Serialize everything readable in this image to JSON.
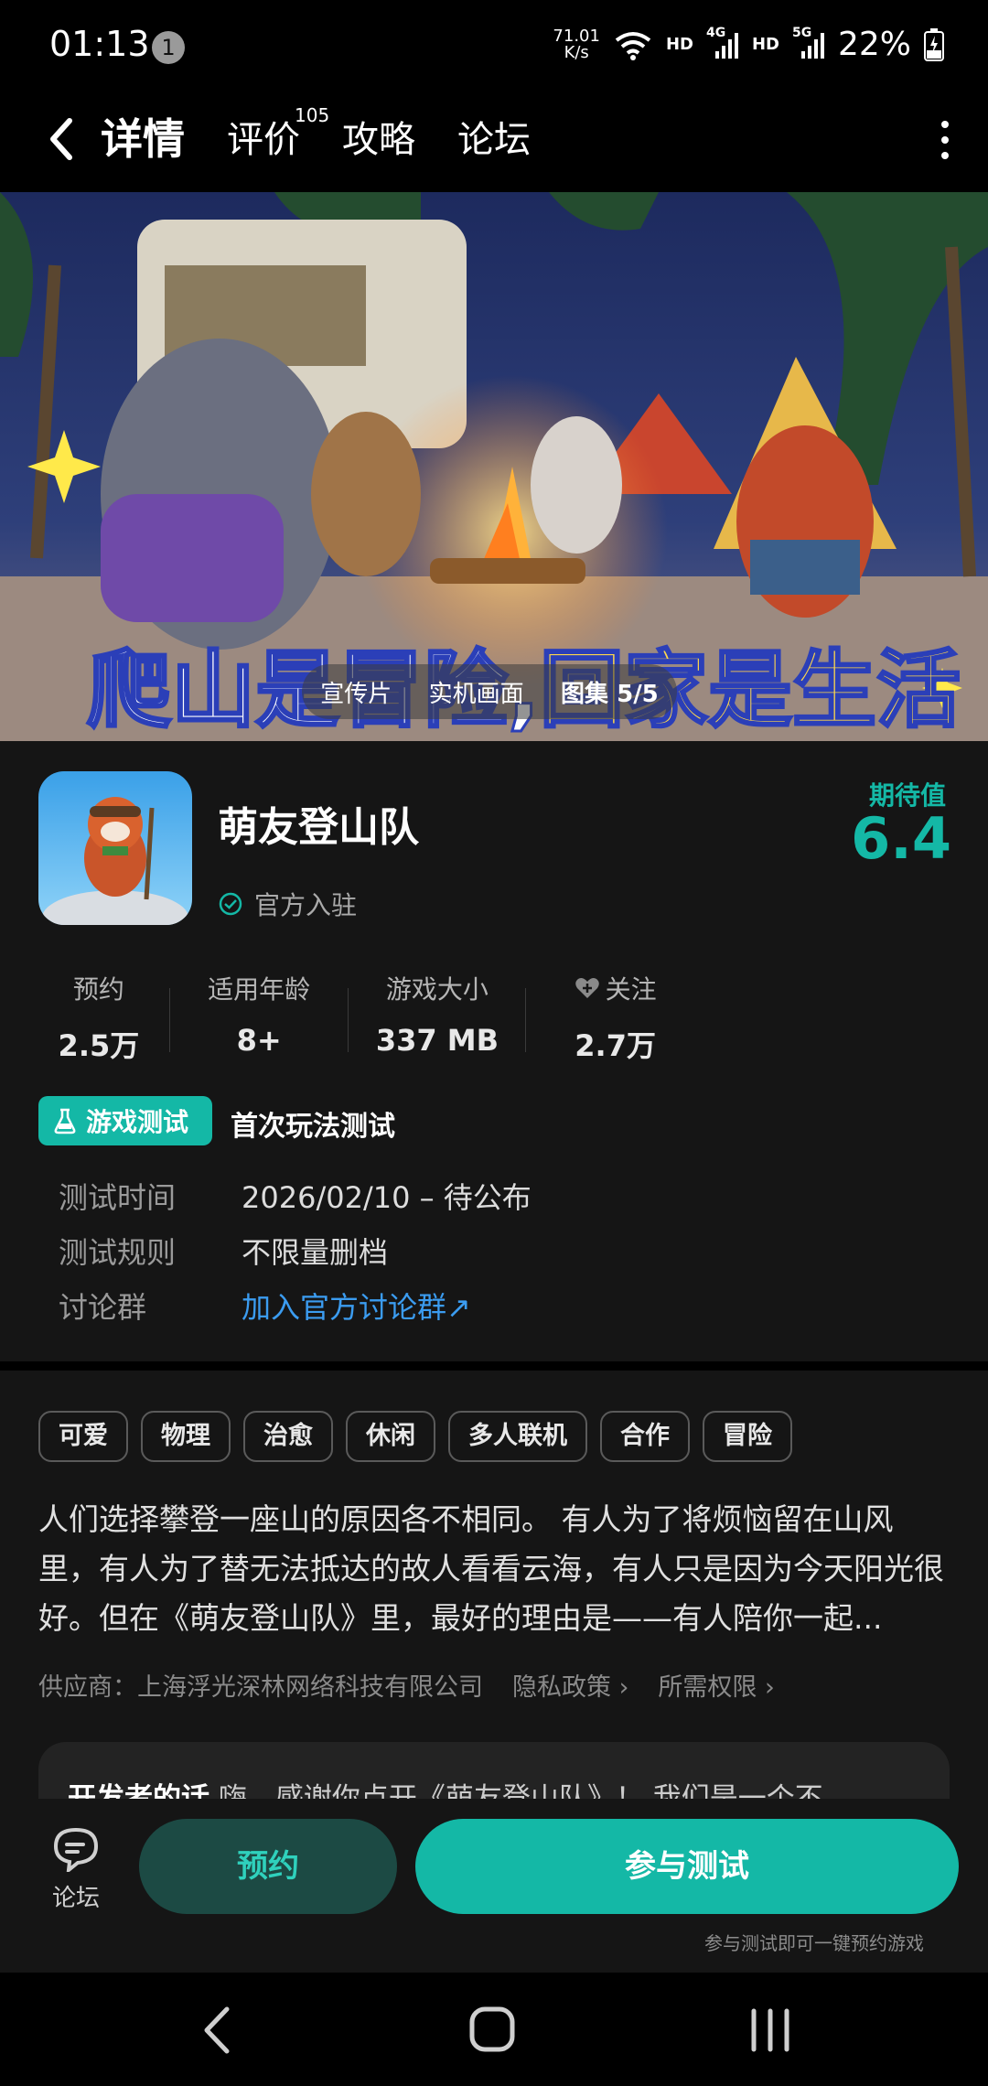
{
  "status_bar": {
    "time": "01:13",
    "notification_count": "1",
    "net_speed_value": "71.01",
    "net_speed_unit": "K/s",
    "hd1": "HD",
    "sig1": "4G",
    "hd2": "HD",
    "sig2": "5G",
    "battery": "22%"
  },
  "nav": {
    "tabs": [
      {
        "label": "详情"
      },
      {
        "label": "评价",
        "badge": "105"
      },
      {
        "label": "攻略"
      },
      {
        "label": "论坛"
      }
    ]
  },
  "hero": {
    "caption_part1": "爬山是冒险,",
    "caption_part2": "回家是生活",
    "media_tabs": [
      "宣传片",
      "实机画面",
      "图集 5/5"
    ]
  },
  "app": {
    "name": "萌友登山队",
    "official_label": "官方入驻",
    "score_label": "期待值",
    "score_value": "6.4"
  },
  "stats": [
    {
      "label": "预约",
      "value": "2.5万"
    },
    {
      "label": "适用年龄",
      "value": "8+"
    },
    {
      "label": "游戏大小",
      "value": "337 MB"
    },
    {
      "label": "关注",
      "value": "2.7万"
    }
  ],
  "test": {
    "badge": "游戏测试",
    "title": "首次玩法测试",
    "rows": [
      {
        "key": "测试时间",
        "value": "2026/02/10 – 待公布"
      },
      {
        "key": "测试规则",
        "value": "不限量删档"
      },
      {
        "key": "讨论群",
        "value": "加入官方讨论群↗"
      }
    ]
  },
  "tags": [
    "可爱",
    "物理",
    "治愈",
    "休闲",
    "多人联机",
    "合作",
    "冒险"
  ],
  "description": "人们选择攀登一座山的原因各不相同。 有人为了将烦恼留在山风里，有人为了替无法抵达的故人看看云海，有人只是因为今天阳光很好。但在《萌友登山队》里，最好的理由是——有人陪你一起...",
  "supplier": {
    "text": "供应商：上海浮光深林网络科技有限公司",
    "privacy": "隐私政策 ›",
    "permissions": "所需权限 ›"
  },
  "dev_note": {
    "title": "开发者的话",
    "text": "嗨，感谢你点开《萌友登山队》！ 我们是一个不"
  },
  "actions": {
    "forum_label": "论坛",
    "reserve_label": "预约",
    "join_label": "参与测试",
    "join_hint": "参与测试即可一键预约游戏"
  },
  "colors": {
    "accent": "#14b8a6",
    "link": "#3b9cf0",
    "background": "#151515"
  }
}
